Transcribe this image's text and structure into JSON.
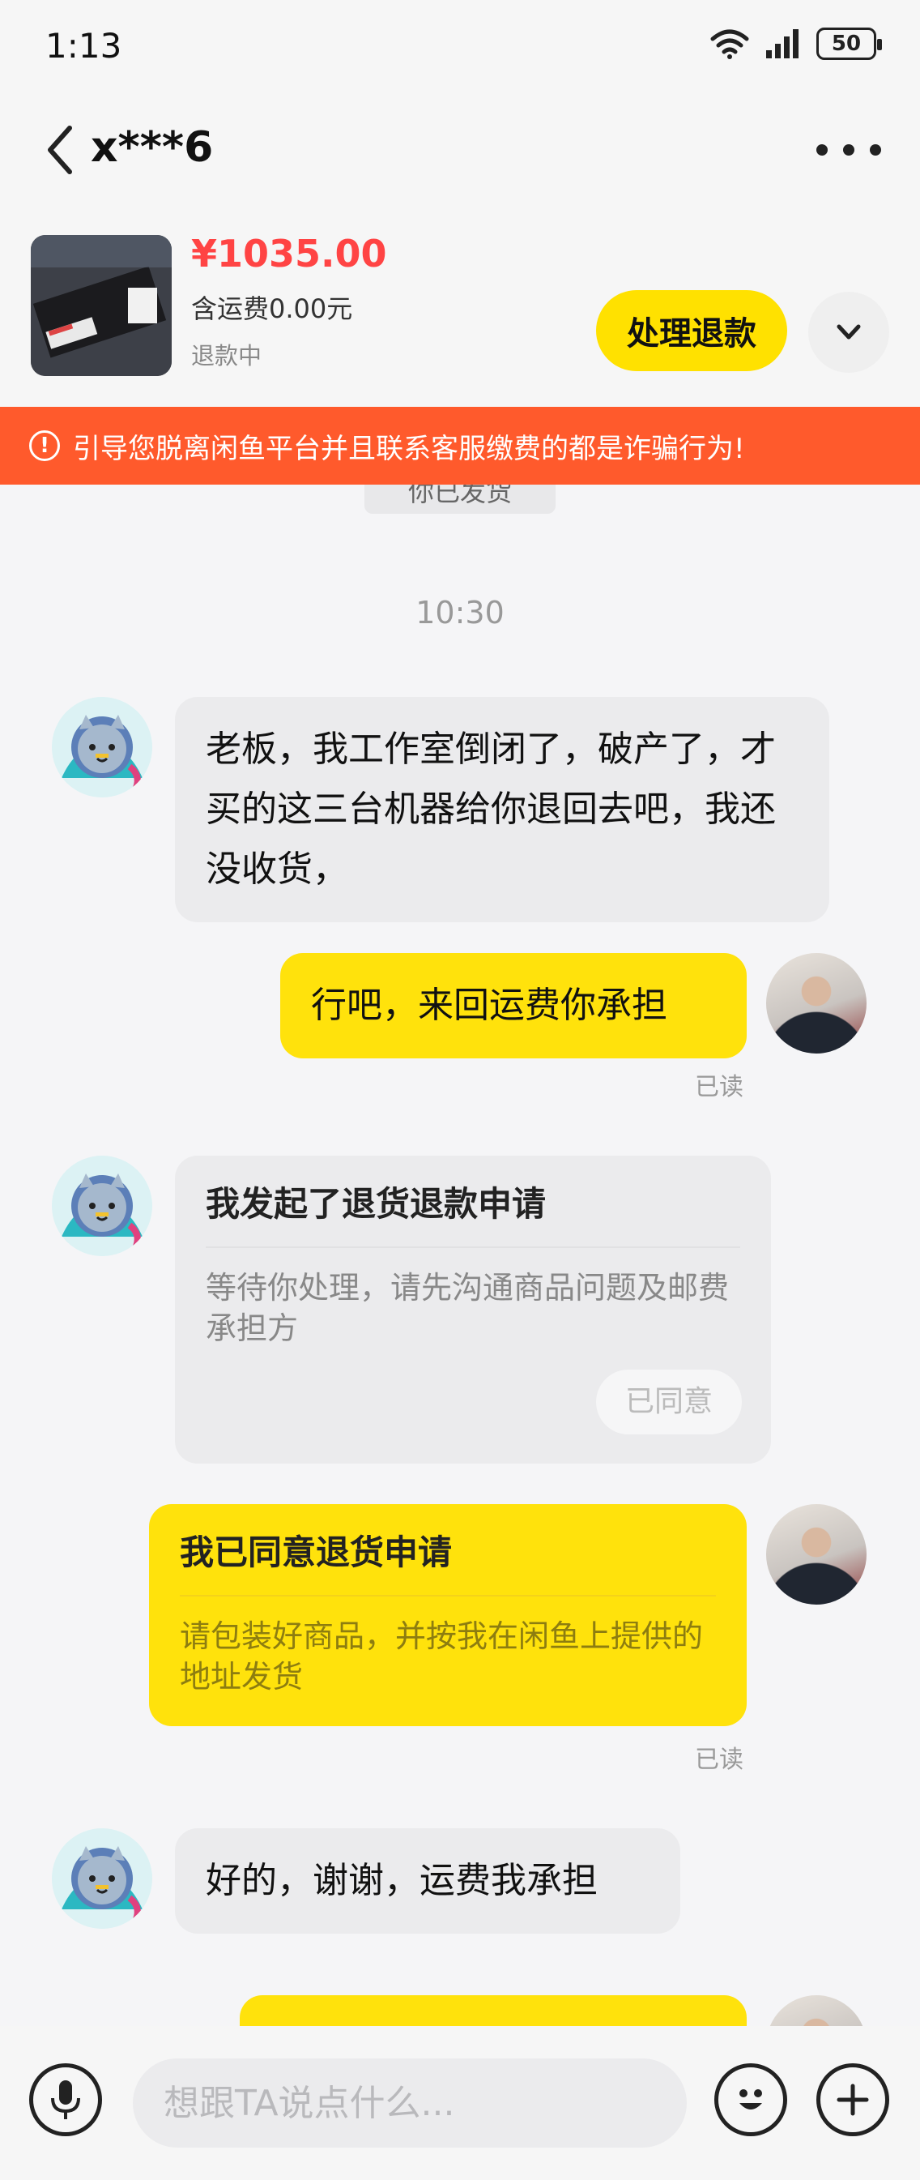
{
  "status_bar": {
    "time": "1:13",
    "battery": "50"
  },
  "header": {
    "contact_name": "x***6"
  },
  "product": {
    "price": "¥1035.00",
    "shipping": "含运费0.00元",
    "status": "退款中",
    "action_label": "处理退款"
  },
  "warning": {
    "text": "引导您脱离闲鱼平台并且联系客服缴费的都是诈骗行为!"
  },
  "chat": {
    "peek_label": "你已发货",
    "timestamp": "10:30",
    "messages": [
      {
        "side": "in",
        "text": "老板，我工作室倒闭了，破产了，才买的这三台机器给你退回去吧，我还没收货，"
      },
      {
        "side": "out",
        "text": "行吧，来回运费你承担",
        "read": "已读"
      },
      {
        "side": "in",
        "card_title": "我发起了退货退款申请",
        "card_body": "等待你处理，请先沟通商品问题及邮费承担方",
        "button": "已同意"
      },
      {
        "side": "out",
        "card_title": "我已同意退货申请",
        "card_body": "请包装好商品，并按我在闲鱼上提供的地址发货",
        "read": "已读"
      },
      {
        "side": "in",
        "text": "好的，谢谢，运费我承担"
      }
    ]
  },
  "input": {
    "placeholder": "想跟TA说点什么..."
  }
}
